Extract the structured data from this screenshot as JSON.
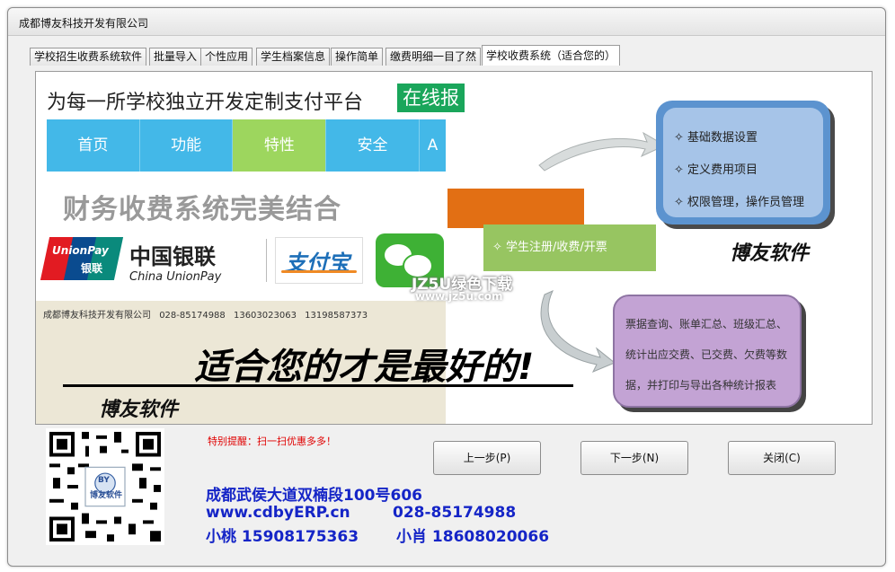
{
  "window": {
    "title": "成都博友科技开发有限公司"
  },
  "tabs": [
    {
      "label": "学校招生收费系统软件"
    },
    {
      "label": "批量导入"
    },
    {
      "label": "个性应用"
    },
    {
      "label": "学生档案信息"
    },
    {
      "label": "操作简单"
    },
    {
      "label": "缴费明细一目了然"
    },
    {
      "label": "学校收费系统（适合您的）"
    }
  ],
  "ad": {
    "headline": "为每一所学校独立开发定制支付平台",
    "online_badge": "在线报",
    "menu": [
      "首页",
      "功能",
      "特性",
      "安全",
      "A"
    ],
    "slogan": "财务收费系统完美结合",
    "logos": {
      "unionpay_en": "UnionPay",
      "unionpay_cn": "银联",
      "cup_cn": "中国银联",
      "cup_en": "China UnionPay",
      "alipay": "支付宝"
    },
    "company_line": [
      "成都博友科技开发有限公司",
      "028-85174988",
      "13603023063",
      "13198587373"
    ],
    "slogan2": "适合您的才是最好的!",
    "brand": "博友软件"
  },
  "flow": {
    "blue_items": [
      "✧ 基础数据设置",
      "✧ 定义费用项目",
      "✧ 权限管理，操作员管理"
    ],
    "green_item": "✧ 学生注册/收费/开票",
    "purple_lines": [
      "票据查询、账单汇总、班级汇总、",
      "统计出应交费、已交费、欠费等数",
      "据，并打印与导出各种统计报表"
    ],
    "brand": "博友软件",
    "watermark": "JZ5U绿色下载",
    "watermark_url": "www.jz5u.com"
  },
  "qr": {
    "logo_text": "BY",
    "caption": "博友软件"
  },
  "bottom": {
    "notice": "特别提醒：扫一扫优惠多多！",
    "prev": "上一步(P)",
    "next": "下一步(N)",
    "close": "关闭(C)",
    "address": "成都武侯大道双楠段100号606",
    "website": "www.cdbyERP.cn",
    "phone": "028-85174988",
    "contact1": "小桃 15908175363",
    "contact2": "小肖 18608020066"
  },
  "colors": {
    "menu_blue": "#43b8e8",
    "menu_active": "#9dd65e",
    "address_blue": "#1525c7",
    "notice_red": "#e00000",
    "orange": "#e26f14"
  }
}
